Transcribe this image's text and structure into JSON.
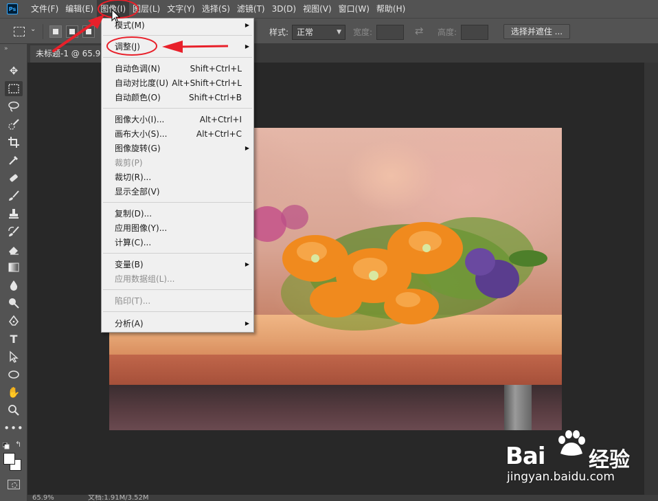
{
  "app": {
    "logo": "Ps"
  },
  "menubar": {
    "items": [
      {
        "label": "文件(F)"
      },
      {
        "label": "编辑(E)"
      },
      {
        "label": "图像(I)"
      },
      {
        "label": "图层(L)"
      },
      {
        "label": "文字(Y)"
      },
      {
        "label": "选择(S)"
      },
      {
        "label": "滤镜(T)"
      },
      {
        "label": "3D(D)"
      },
      {
        "label": "视图(V)"
      },
      {
        "label": "窗口(W)"
      },
      {
        "label": "帮助(H)"
      }
    ]
  },
  "options": {
    "style_label": "样式:",
    "style_value": "正常",
    "width_label": "宽度:",
    "height_label": "高度:",
    "select_mask_button": "选择并遮住 ..."
  },
  "document": {
    "tab_title": "未标题-1 @ 65.9%",
    "zoom": "65.9%",
    "doc_info": "文档:1.91M/3.52M"
  },
  "image_menu": {
    "items": [
      {
        "label": "模式(M)",
        "shortcut": "",
        "submenu": true,
        "disabled": false
      },
      {
        "label": "调整(J)",
        "shortcut": "",
        "submenu": true,
        "disabled": false
      },
      {
        "label": "自动色调(N)",
        "shortcut": "Shift+Ctrl+L",
        "submenu": false,
        "disabled": false
      },
      {
        "label": "自动对比度(U)",
        "shortcut": "Alt+Shift+Ctrl+L",
        "submenu": false,
        "disabled": false
      },
      {
        "label": "自动颜色(O)",
        "shortcut": "Shift+Ctrl+B",
        "submenu": false,
        "disabled": false
      },
      {
        "label": "图像大小(I)...",
        "shortcut": "Alt+Ctrl+I",
        "submenu": false,
        "disabled": false
      },
      {
        "label": "画布大小(S)...",
        "shortcut": "Alt+Ctrl+C",
        "submenu": false,
        "disabled": false
      },
      {
        "label": "图像旋转(G)",
        "shortcut": "",
        "submenu": true,
        "disabled": false
      },
      {
        "label": "裁剪(P)",
        "shortcut": "",
        "submenu": false,
        "disabled": true
      },
      {
        "label": "裁切(R)...",
        "shortcut": "",
        "submenu": false,
        "disabled": false
      },
      {
        "label": "显示全部(V)",
        "shortcut": "",
        "submenu": false,
        "disabled": false
      },
      {
        "label": "复制(D)...",
        "shortcut": "",
        "submenu": false,
        "disabled": false
      },
      {
        "label": "应用图像(Y)...",
        "shortcut": "",
        "submenu": false,
        "disabled": false
      },
      {
        "label": "计算(C)...",
        "shortcut": "",
        "submenu": false,
        "disabled": false
      },
      {
        "label": "变量(B)",
        "shortcut": "",
        "submenu": true,
        "disabled": false
      },
      {
        "label": "应用数据组(L)...",
        "shortcut": "",
        "submenu": false,
        "disabled": true
      },
      {
        "label": "陷印(T)...",
        "shortcut": "",
        "submenu": false,
        "disabled": true
      },
      {
        "label": "分析(A)",
        "shortcut": "",
        "submenu": true,
        "disabled": false
      }
    ]
  },
  "tools": [
    "move-tool-icon",
    "rectangular-marquee-icon",
    "lasso-icon",
    "quick-selection-icon",
    "crop-icon",
    "eyedropper-icon",
    "healing-brush-icon",
    "brush-icon",
    "clone-stamp-icon",
    "history-brush-icon",
    "eraser-icon",
    "gradient-icon",
    "blur-icon",
    "dodge-icon",
    "pen-icon",
    "type-icon",
    "path-selection-icon",
    "ellipse-icon",
    "hand-icon",
    "zoom-icon",
    "more-tools-icon"
  ],
  "watermark": {
    "brand": "Bai",
    "brand_cn": "经验",
    "url": "jingyan.baidu.com"
  },
  "colors": {
    "annotation": "#e8202a",
    "ui_dark": "#535353",
    "menu_bg": "#f0f0f0"
  }
}
